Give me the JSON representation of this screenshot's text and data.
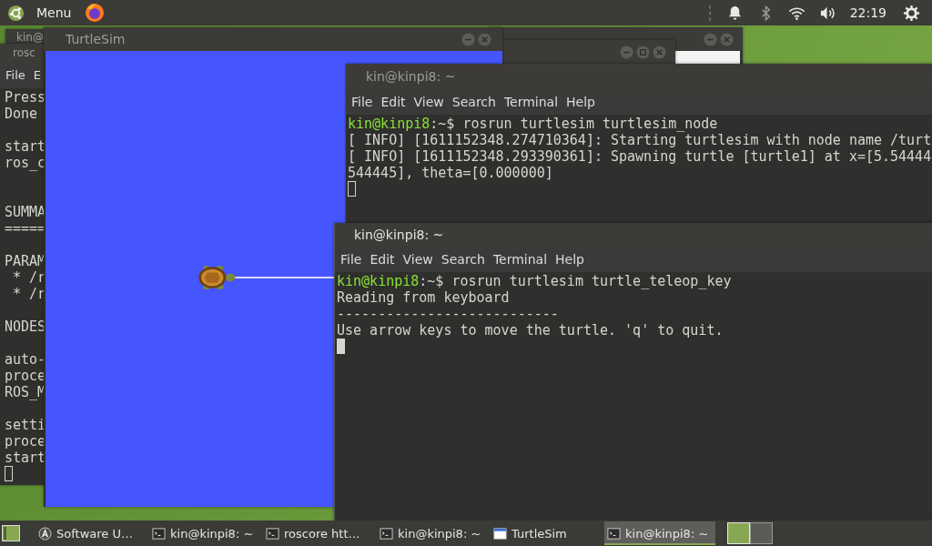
{
  "top_panel": {
    "menu_label": "Menu",
    "clock": "22:19"
  },
  "background_window": {
    "title": "kin@"
  },
  "roscore_terminal": {
    "title": "rosc",
    "menu": [
      "File",
      "E"
    ],
    "focused": false,
    "lines": [
      {
        "kind": "output",
        "text": "Press"
      },
      {
        "kind": "output",
        "text": "Done"
      },
      {
        "kind": "blank"
      },
      {
        "kind": "output",
        "text": "start"
      },
      {
        "kind": "output",
        "text": "ros_c"
      },
      {
        "kind": "blank"
      },
      {
        "kind": "blank"
      },
      {
        "kind": "output",
        "text": "SUMMA"
      },
      {
        "kind": "output",
        "text": "====="
      },
      {
        "kind": "blank"
      },
      {
        "kind": "output",
        "text": "PARAM"
      },
      {
        "kind": "output",
        "text": " * /r"
      },
      {
        "kind": "output",
        "text": " * /r"
      },
      {
        "kind": "blank"
      },
      {
        "kind": "output",
        "text": "NODES"
      },
      {
        "kind": "blank"
      },
      {
        "kind": "output",
        "text": "auto-"
      },
      {
        "kind": "output",
        "text": "proce"
      },
      {
        "kind": "output",
        "text": "ROS_M"
      },
      {
        "kind": "blank"
      },
      {
        "kind": "output",
        "text": "setti"
      },
      {
        "kind": "output",
        "text": "proce"
      },
      {
        "kind": "output",
        "text": "start"
      }
    ]
  },
  "turtlesim": {
    "title": "TurtleSim"
  },
  "terminal_1": {
    "title": "kin@kinpi8: ~",
    "menu": [
      "File",
      "Edit",
      "View",
      "Search",
      "Terminal",
      "Help"
    ],
    "focused": false,
    "lines": [
      {
        "kind": "prompt",
        "user": "kin@kinpi8",
        "prompt": ":~$ ",
        "command": "rosrun turtlesim turtlesim_node"
      },
      {
        "kind": "output",
        "text": "[ INFO] [1611152348.274710364]: Starting turtlesim with node name /turt"
      },
      {
        "kind": "output",
        "text": "[ INFO] [1611152348.293390361]: Spawning turtle [turtle1] at x=[5.54444"
      },
      {
        "kind": "output",
        "text": "544445], theta=[0.000000]"
      }
    ]
  },
  "terminal_2": {
    "title": "kin@kinpi8: ~",
    "menu": [
      "File",
      "Edit",
      "View",
      "Search",
      "Terminal",
      "Help"
    ],
    "focused": true,
    "lines": [
      {
        "kind": "prompt",
        "user": "kin@kinpi8",
        "prompt": ":~$ ",
        "command": "rosrun turtlesim turtle_teleop_key"
      },
      {
        "kind": "output",
        "text": "Reading from keyboard"
      },
      {
        "kind": "output",
        "text": "---------------------------"
      },
      {
        "kind": "output",
        "text": "Use arrow keys to move the turtle. 'q' to quit."
      }
    ]
  },
  "taskbar": {
    "items": [
      {
        "kind": "software",
        "label": "Software U…",
        "selected": false
      },
      {
        "kind": "terminal",
        "label": "kin@kinpi8: ~",
        "selected": false
      },
      {
        "kind": "terminal",
        "label": "roscore htt…",
        "selected": false
      },
      {
        "kind": "terminal",
        "label": "kin@kinpi8: ~",
        "selected": false
      },
      {
        "kind": "window",
        "label": "TurtleSim",
        "selected": false
      },
      {
        "kind": "terminal",
        "label": "kin@kinpi8: ~",
        "selected": true
      }
    ],
    "workspaces": [
      {
        "selected": true
      },
      {
        "selected": false
      }
    ]
  }
}
